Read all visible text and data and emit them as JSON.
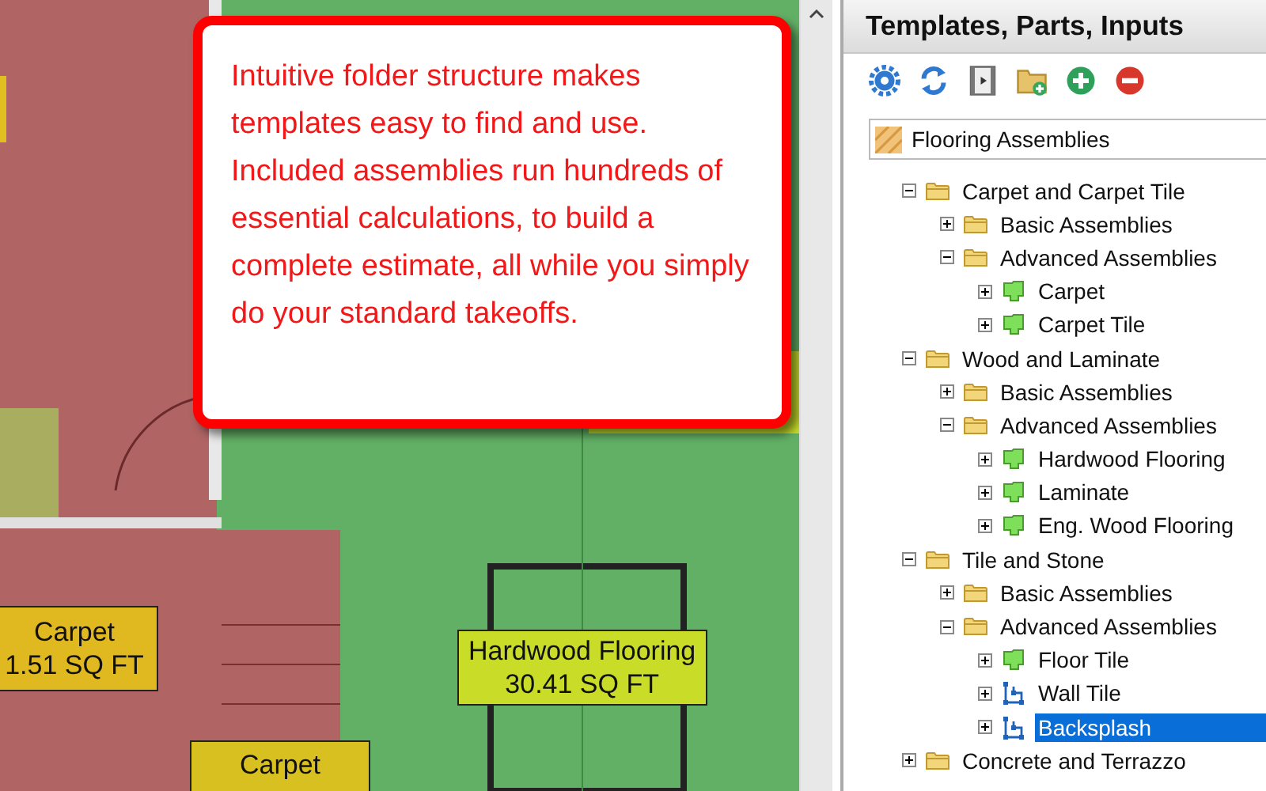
{
  "callout": {
    "text": "Intuitive folder structure makes templates easy to find and use. Included assemblies run hundreds of essential calculations, to build a complete estimate, all while you simply do your standard takeoffs."
  },
  "plan_labels": [
    {
      "lines": [
        "Carpet",
        "1.51 SQ FT"
      ],
      "color": "#e0b820"
    },
    {
      "lines": [
        "Hardwood Flooring",
        "30.41 SQ FT"
      ],
      "color": "#c8dc28"
    },
    {
      "lines": [
        "Carpet"
      ],
      "color": "#d8c020"
    }
  ],
  "panel": {
    "title": "Templates, Parts, Inputs",
    "toolbar": [
      {
        "kind": "settings"
      },
      {
        "kind": "refresh"
      },
      {
        "kind": "film"
      },
      {
        "kind": "new-folder"
      },
      {
        "kind": "add"
      },
      {
        "kind": "remove"
      }
    ],
    "dropdown": {
      "value": "Flooring Assemblies"
    },
    "tree": [
      {
        "label": "Carpet and Carpet Tile",
        "kind": "folder",
        "expanded": true,
        "selected": false,
        "children": [
          {
            "label": "Basic Assemblies",
            "kind": "folder",
            "expanded": false,
            "selected": false
          },
          {
            "label": "Advanced Assemblies",
            "kind": "folder",
            "expanded": true,
            "selected": false,
            "children": [
              {
                "label": "Carpet",
                "kind": "area",
                "expanded": false,
                "selected": false
              },
              {
                "label": "Carpet Tile",
                "kind": "area",
                "expanded": false,
                "selected": false
              }
            ]
          }
        ]
      },
      {
        "label": "Wood and Laminate",
        "kind": "folder",
        "expanded": true,
        "selected": false,
        "children": [
          {
            "label": "Basic Assemblies",
            "kind": "folder",
            "expanded": false,
            "selected": false
          },
          {
            "label": "Advanced Assemblies",
            "kind": "folder",
            "expanded": true,
            "selected": false,
            "children": [
              {
                "label": "Hardwood Flooring",
                "kind": "area",
                "expanded": false,
                "selected": false
              },
              {
                "label": "Laminate",
                "kind": "area",
                "expanded": false,
                "selected": false
              },
              {
                "label": "Eng. Wood Flooring",
                "kind": "area",
                "expanded": false,
                "selected": false
              }
            ]
          }
        ]
      },
      {
        "label": "Tile and Stone",
        "kind": "folder",
        "expanded": true,
        "selected": false,
        "children": [
          {
            "label": "Basic Assemblies",
            "kind": "folder",
            "expanded": false,
            "selected": false
          },
          {
            "label": "Advanced Assemblies",
            "kind": "folder",
            "expanded": true,
            "selected": false,
            "children": [
              {
                "label": "Floor Tile",
                "kind": "area",
                "expanded": false,
                "selected": false
              },
              {
                "label": "Wall Tile",
                "kind": "linear",
                "expanded": false,
                "selected": false
              },
              {
                "label": "Backsplash",
                "kind": "linear",
                "expanded": false,
                "selected": true
              }
            ]
          }
        ]
      },
      {
        "label": "Concrete and Terrazzo",
        "kind": "folder",
        "expanded": false,
        "selected": false
      }
    ]
  }
}
